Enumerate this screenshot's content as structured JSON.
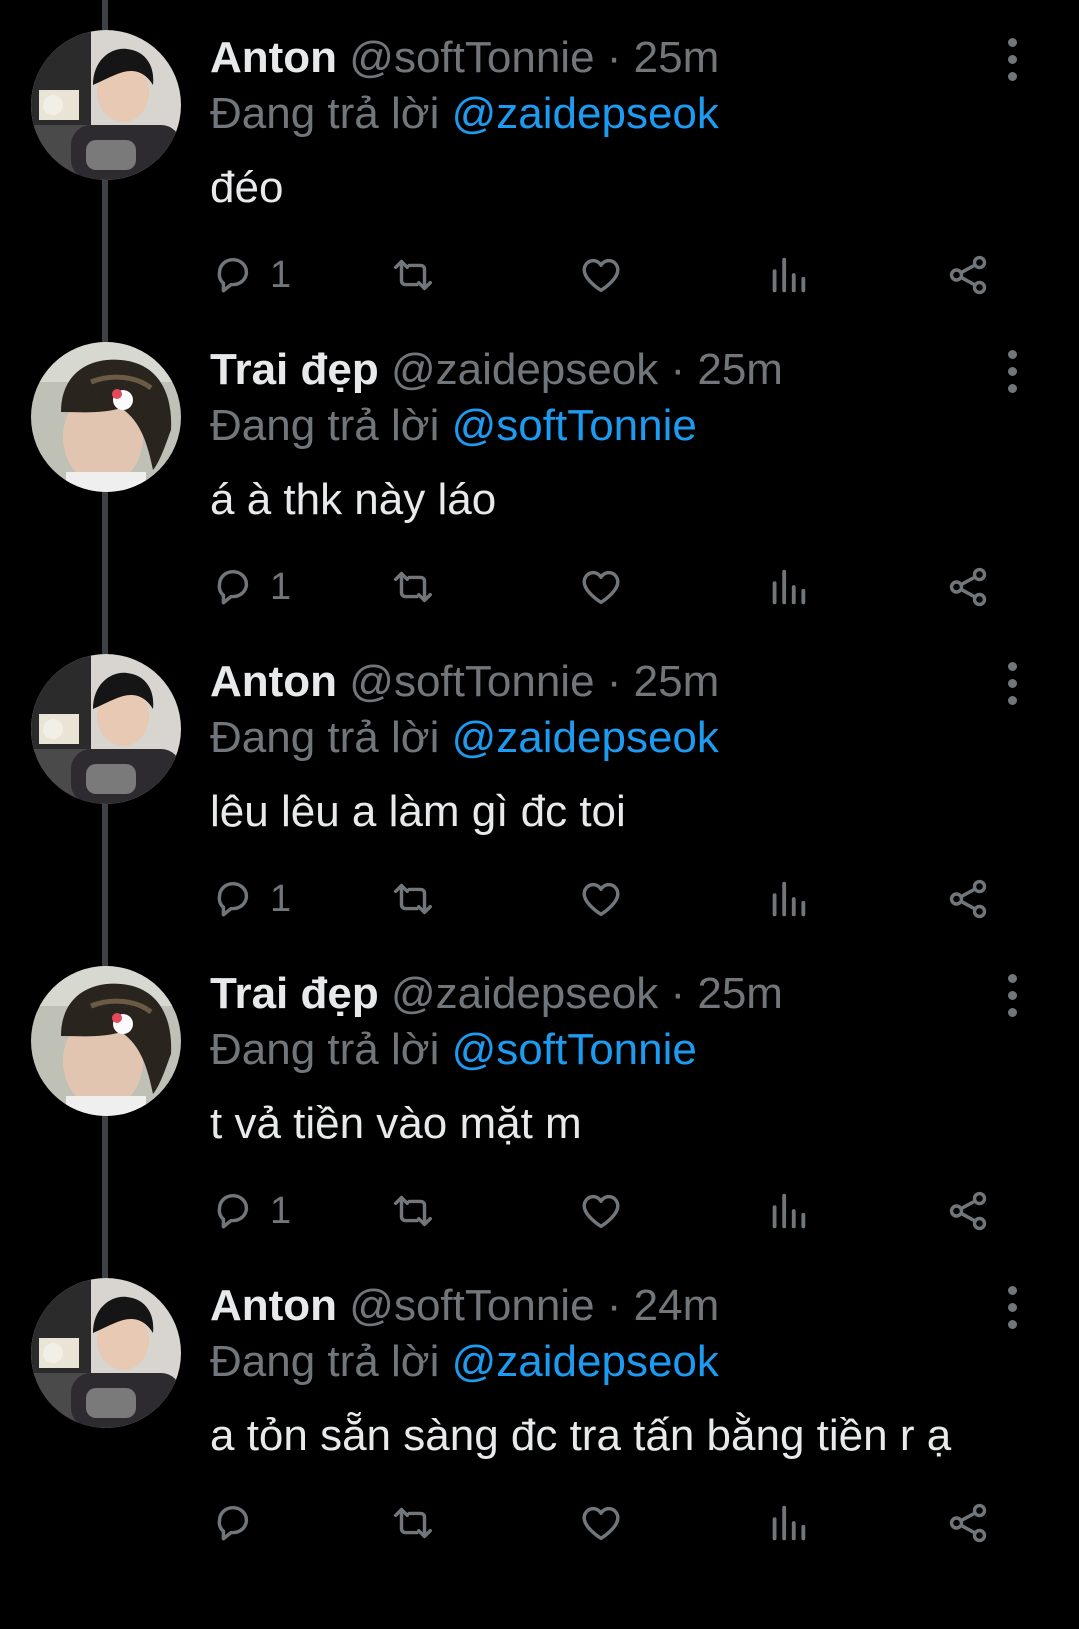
{
  "tweets": [
    {
      "name": "Anton",
      "handle": "@softTonnie",
      "separator": "·",
      "time": "25m",
      "reply_prefix": "Đang trả lời",
      "reply_to": "@zaidepseok",
      "text": "đéo",
      "reply_count": "1",
      "avatar": "anton"
    },
    {
      "name": "Trai đẹp",
      "handle": "@zaidepseok",
      "separator": "·",
      "time": "25m",
      "reply_prefix": "Đang trả lời",
      "reply_to": "@softTonnie",
      "text": "á à thk này láo",
      "reply_count": "1",
      "avatar": "traidep"
    },
    {
      "name": "Anton",
      "handle": "@softTonnie",
      "separator": "·",
      "time": "25m",
      "reply_prefix": "Đang trả lời",
      "reply_to": "@zaidepseok",
      "text": "lêu lêu a làm gì đc toi",
      "reply_count": "1",
      "avatar": "anton"
    },
    {
      "name": "Trai đẹp",
      "handle": "@zaidepseok",
      "separator": "·",
      "time": "25m",
      "reply_prefix": "Đang trả lời",
      "reply_to": "@softTonnie",
      "text": "t vả tiền vào mặt m",
      "reply_count": "1",
      "avatar": "traidep"
    },
    {
      "name": "Anton",
      "handle": "@softTonnie",
      "separator": "·",
      "time": "24m",
      "reply_prefix": "Đang trả lời",
      "reply_to": "@zaidepseok",
      "text": "a tỏn sẵn sàng đc tra tấn bằng tiền r ạ",
      "reply_count": "",
      "avatar": "anton"
    }
  ],
  "icons": {
    "reply": "reply-icon",
    "retweet": "retweet-icon",
    "like": "heart-icon",
    "views": "views-icon",
    "share": "share-icon",
    "more": "more-vertical-icon"
  },
  "colors": {
    "background": "#000000",
    "text": "#e7e9ea",
    "secondary": "#71767b",
    "accent": "#1d9bf0",
    "thread_line": "#3e4144"
  }
}
